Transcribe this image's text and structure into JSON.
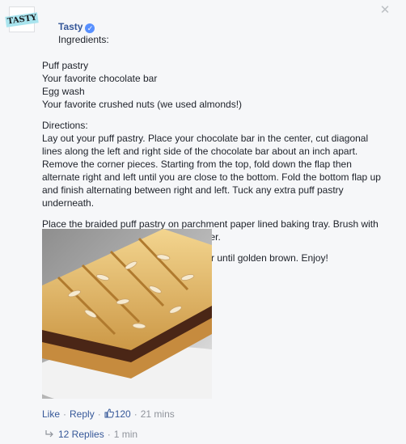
{
  "comment": {
    "author": "Tasty",
    "avatar_text": "TASTY",
    "ingredients_heading": "Ingredients:",
    "ingredients": [
      "Puff pastry",
      "Your favorite chocolate bar",
      "Egg wash",
      "Your favorite crushed nuts (we used almonds!)"
    ],
    "directions_heading": "Directions:",
    "directions_p1": "Lay out your puff pastry. Place your chocolate bar in the center, cut diagonal lines along the left and right side of the chocolate bar about an inch apart. Remove the corner pieces. Starting from the top, fold down the flap then alternate right and left until you are close to the bottom. Fold the bottom flap up and finish alternating between right and left. Tuck any extra puff pastry underneath.",
    "directions_p2": "Place the braided puff pastry on parchment paper lined baking tray. Brush with egg wash and sprinkle crushed nuts over.",
    "directions_p3": "Bake at 415°F / 213°C for 25 minutes or until golden brown. Enjoy!",
    "close_glyph": "✕"
  },
  "actions": {
    "like_label": "Like",
    "reply_label": "Reply",
    "like_count": "120",
    "time": "21 mins",
    "separator": "·"
  },
  "replies": {
    "label": "12 Replies",
    "time": "1 min",
    "separator": "·"
  },
  "colors": {
    "link": "#365899",
    "muted": "#90949c",
    "verified": "#5890ff",
    "background": "#f6f7f9"
  },
  "icons": {
    "verified": "verified-badge-icon",
    "like": "thumbs-up-icon",
    "reply": "reply-arrow-icon",
    "close": "close-icon"
  }
}
